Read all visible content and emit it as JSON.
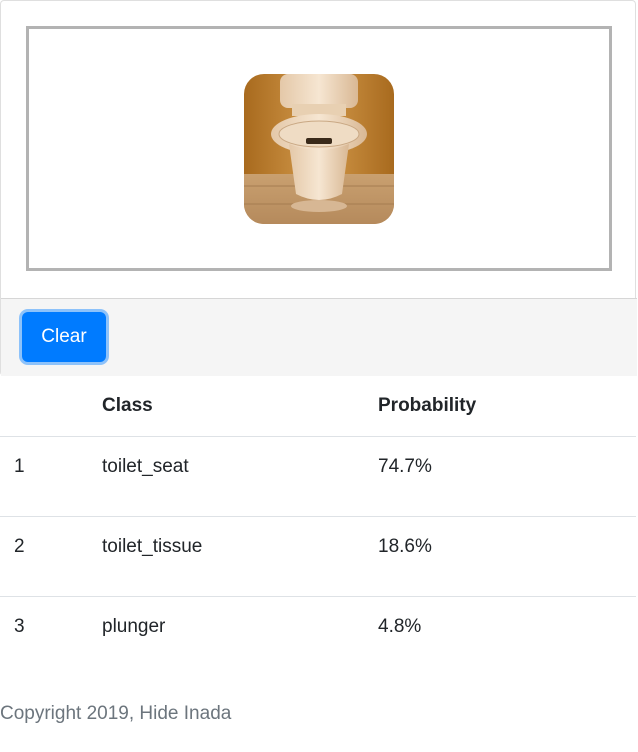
{
  "upload": {
    "image_alt": "toilet photo thumbnail"
  },
  "actions": {
    "clear_label": "Clear"
  },
  "results": {
    "headers": {
      "rank": "",
      "class": "Class",
      "probability": "Probability"
    },
    "rows": [
      {
        "rank": "1",
        "class": "toilet_seat",
        "probability": "74.7%"
      },
      {
        "rank": "2",
        "class": "toilet_tissue",
        "probability": "18.6%"
      },
      {
        "rank": "3",
        "class": "plunger",
        "probability": "4.8%"
      }
    ]
  },
  "footer": {
    "copyright": "Copyright 2019, Hide Inada"
  },
  "colors": {
    "primary_button": "#007bff",
    "footer_text": "#6c757d",
    "drop_zone_border": "#b3b3b3"
  }
}
